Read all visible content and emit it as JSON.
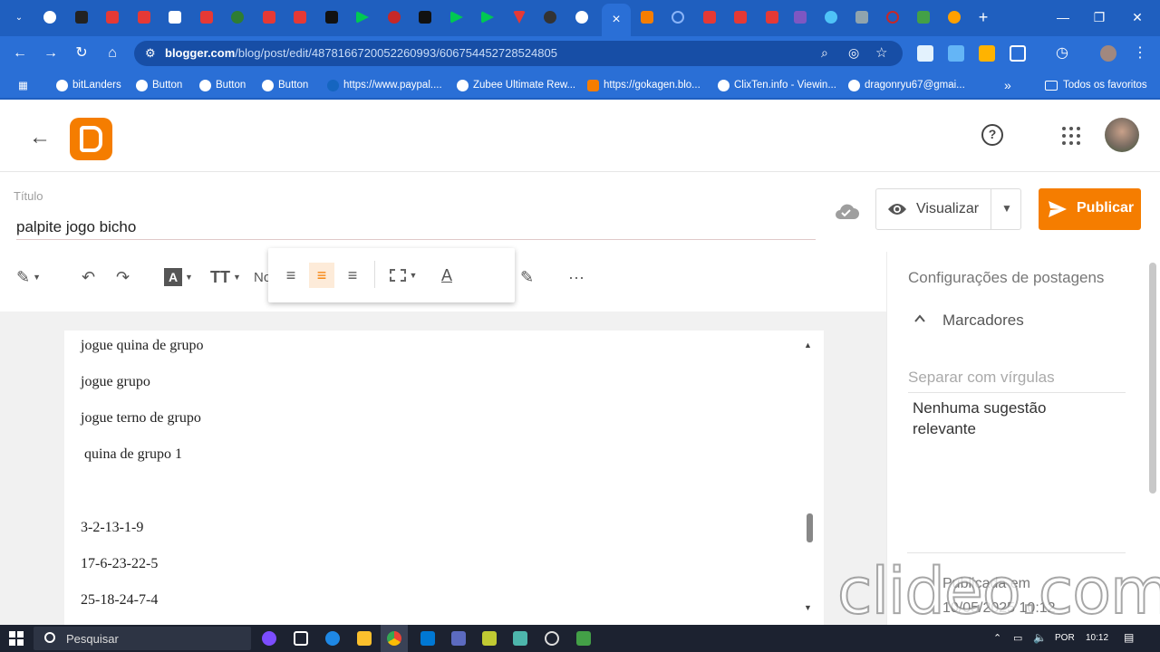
{
  "browser": {
    "url_host": "blogger.com",
    "url_path": "/blog/post/edit/4878166720052260993/606754452728524805",
    "close_tab_label": "×",
    "new_tab_label": "+",
    "bookmarks": [
      {
        "label": "bitLanders"
      },
      {
        "label": "Button"
      },
      {
        "label": "Button"
      },
      {
        "label": "Button"
      },
      {
        "label": "https://www.paypal...."
      },
      {
        "label": "Zubee Ultimate Rew..."
      },
      {
        "label": "https://gokagen.blo..."
      },
      {
        "label": "ClixTen.info - Viewin..."
      },
      {
        "label": "dragonryu67@gmai..."
      }
    ],
    "more_bookmarks": "»",
    "all_bookmarks": "Todos os favoritos"
  },
  "header": {
    "help": "?"
  },
  "post": {
    "title_label": "Título",
    "title_value": "palpite jogo bicho",
    "preview_label": "Visualizar",
    "publish_label": "Publicar"
  },
  "toolbar": {
    "normal_text_partial": "No"
  },
  "editor": {
    "lines": [
      "jogue quina de grupo",
      "jogue grupo",
      "jogue terno de grupo",
      " quina de grupo 1",
      "",
      "3-2-13-1-9",
      "17-6-23-22-5",
      "25-18-24-7-4"
    ]
  },
  "sidebar": {
    "title": "Configurações de postagens",
    "labels_section": "Marcadores",
    "labels_placeholder": "Separar com vírgulas",
    "no_suggestions": "Nenhuma sugestão relevante",
    "published_label": "Publicada em",
    "published_date": "10/05/2025 10:12"
  },
  "watermark": "clideo.com",
  "taskbar": {
    "search_placeholder": "Pesquisar",
    "language": "POR",
    "time": "10:12"
  },
  "colors": {
    "chrome_blue": "#2a6fd6",
    "blogger_orange": "#f57d00",
    "taskbar": "#1c2230"
  }
}
